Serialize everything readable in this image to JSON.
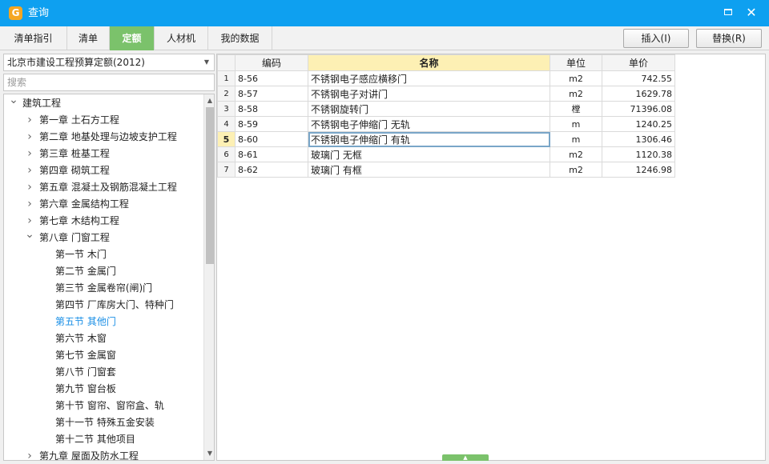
{
  "window": {
    "title": "查询",
    "icon": "app-logo-icon"
  },
  "tabs": [
    {
      "label": "清单指引",
      "active": false
    },
    {
      "label": "清单",
      "active": false
    },
    {
      "label": "定额",
      "active": true
    },
    {
      "label": "人材机",
      "active": false
    },
    {
      "label": "我的数据",
      "active": false
    }
  ],
  "actions": {
    "insert_label": "插入(I)",
    "replace_label": "替换(R)"
  },
  "library": {
    "selected": "北京市建设工程预算定额(2012)"
  },
  "search": {
    "placeholder": "搜索",
    "value": ""
  },
  "tree": [
    {
      "label": "建筑工程",
      "level": 0,
      "state": "expanded"
    },
    {
      "label": "第一章  土石方工程",
      "level": 1,
      "state": "collapsed"
    },
    {
      "label": "第二章  地基处理与边坡支护工程",
      "level": 1,
      "state": "collapsed"
    },
    {
      "label": "第三章  桩基工程",
      "level": 1,
      "state": "collapsed"
    },
    {
      "label": "第四章  砌筑工程",
      "level": 1,
      "state": "collapsed"
    },
    {
      "label": "第五章  混凝土及钢筋混凝土工程",
      "level": 1,
      "state": "collapsed"
    },
    {
      "label": "第六章  金属结构工程",
      "level": 1,
      "state": "collapsed"
    },
    {
      "label": "第七章  木结构工程",
      "level": 1,
      "state": "collapsed"
    },
    {
      "label": "第八章  门窗工程",
      "level": 1,
      "state": "expanded"
    },
    {
      "label": "第一节  木门",
      "level": 2,
      "state": "leaf"
    },
    {
      "label": "第二节  金属门",
      "level": 2,
      "state": "leaf"
    },
    {
      "label": "第三节  金属卷帘(闸)门",
      "level": 2,
      "state": "leaf"
    },
    {
      "label": "第四节  厂库房大门、特种门",
      "level": 2,
      "state": "leaf"
    },
    {
      "label": "第五节  其他门",
      "level": 2,
      "state": "leaf",
      "selected": true
    },
    {
      "label": "第六节  木窗",
      "level": 2,
      "state": "leaf"
    },
    {
      "label": "第七节  金属窗",
      "level": 2,
      "state": "leaf"
    },
    {
      "label": "第八节  门窗套",
      "level": 2,
      "state": "leaf"
    },
    {
      "label": "第九节  窗台板",
      "level": 2,
      "state": "leaf"
    },
    {
      "label": "第十节  窗帘、窗帘盒、轨",
      "level": 2,
      "state": "leaf"
    },
    {
      "label": "第十一节  特殊五金安装",
      "level": 2,
      "state": "leaf"
    },
    {
      "label": "第十二节  其他项目",
      "level": 2,
      "state": "leaf"
    },
    {
      "label": "第九章  屋面及防水工程",
      "level": 1,
      "state": "collapsed"
    }
  ],
  "grid": {
    "headers": {
      "code": "编码",
      "name": "名称",
      "unit": "单位",
      "price": "单价"
    },
    "current_row": 5,
    "rows": [
      {
        "no": "1",
        "code": "8-56",
        "name": "不锈钢电子感应横移门",
        "unit": "m2",
        "price": "742.55"
      },
      {
        "no": "2",
        "code": "8-57",
        "name": "不锈钢电子对讲门",
        "unit": "m2",
        "price": "1629.78"
      },
      {
        "no": "3",
        "code": "8-58",
        "name": "不锈钢旋转门",
        "unit": "樘",
        "price": "71396.08"
      },
      {
        "no": "4",
        "code": "8-59",
        "name": "不锈钢电子伸缩门 无轨",
        "unit": "m",
        "price": "1240.25"
      },
      {
        "no": "5",
        "code": "8-60",
        "name": "不锈钢电子伸缩门 有轨",
        "unit": "m",
        "price": "1306.46"
      },
      {
        "no": "6",
        "code": "8-61",
        "name": "玻璃门 无框",
        "unit": "m2",
        "price": "1120.38"
      },
      {
        "no": "7",
        "code": "8-62",
        "name": "玻璃门 有框",
        "unit": "m2",
        "price": "1246.98"
      }
    ]
  },
  "colors": {
    "titlebar": "#0ea0f0",
    "active_tab": "#7bc26b",
    "selected_tree": "#1a8fe6",
    "header_highlight": "#fdf0b4"
  }
}
